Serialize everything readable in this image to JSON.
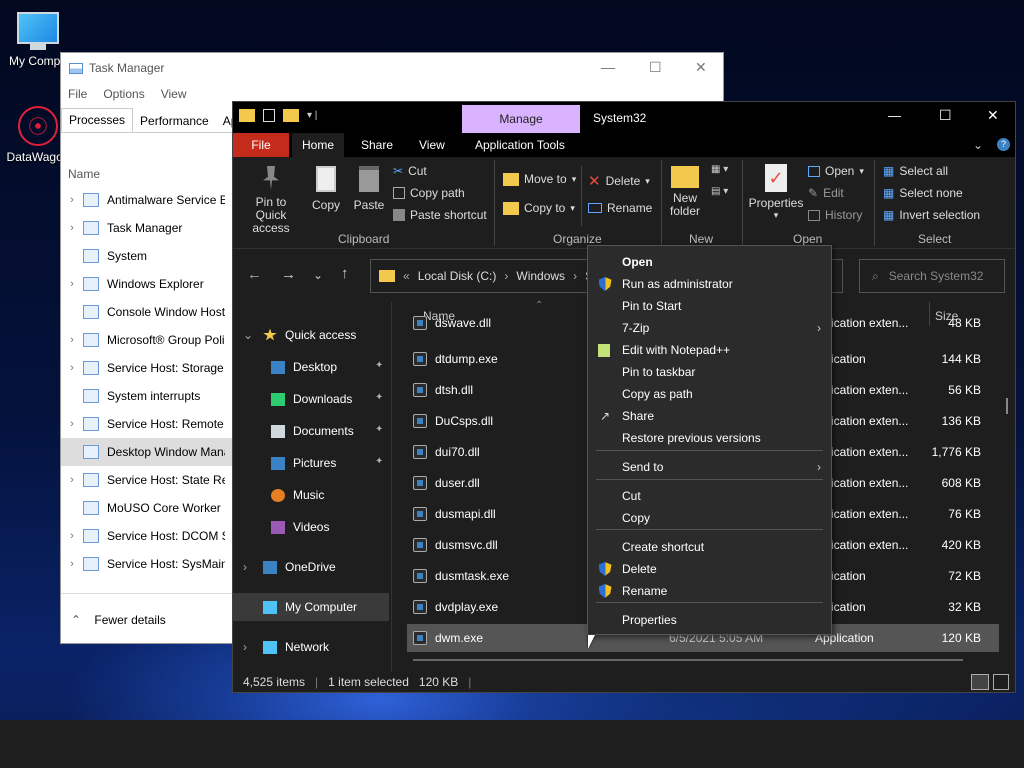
{
  "desktop": {
    "icons": [
      {
        "label": "My Computer",
        "display": "My Compu"
      },
      {
        "label": "DataWagon",
        "display": "DataWagon"
      }
    ]
  },
  "task_manager": {
    "title": "Task Manager",
    "menu": [
      "File",
      "Options",
      "View"
    ],
    "tabs": [
      "Processes",
      "Performance",
      "App"
    ],
    "column_name": "Name",
    "processes": [
      {
        "name": "Antimalware Service Ex",
        "expand": true
      },
      {
        "name": "Task Manager",
        "expand": true
      },
      {
        "name": "System",
        "expand": false
      },
      {
        "name": "Windows Explorer",
        "expand": true
      },
      {
        "name": "Console Window Host",
        "expand": false
      },
      {
        "name": "Microsoft® Group Poli",
        "expand": true
      },
      {
        "name": "Service Host: Storage S",
        "expand": true
      },
      {
        "name": "System interrupts",
        "expand": false
      },
      {
        "name": "Service Host: Remote P",
        "expand": true
      },
      {
        "name": "Desktop Window Mana",
        "expand": false
      },
      {
        "name": "Service Host: State Rep",
        "expand": true
      },
      {
        "name": "MoUSO Core Worker P",
        "expand": false
      },
      {
        "name": "Service Host: DCOM Se",
        "expand": true
      },
      {
        "name": "Service Host: SysMain",
        "expand": true
      }
    ],
    "fewer_details": "Fewer details"
  },
  "explorer": {
    "title": "System32",
    "manage_tab": "Manage",
    "ribbon_tabs": [
      "File",
      "Home",
      "Share",
      "View",
      "Application Tools"
    ],
    "clipboard": {
      "pin": "Pin to Quick access",
      "copy": "Copy",
      "paste": "Paste",
      "cut": "Cut",
      "copy_path": "Copy path",
      "paste_shortcut": "Paste shortcut",
      "group": "Clipboard"
    },
    "organize": {
      "move_to": "Move to",
      "copy_to": "Copy to",
      "delete": "Delete",
      "rename": "Rename",
      "group": "Organize"
    },
    "new": {
      "new_folder": "New folder",
      "group": "New"
    },
    "open": {
      "properties": "Properties",
      "open": "Open",
      "edit": "Edit",
      "history": "History",
      "group": "Open"
    },
    "select": {
      "select_all": "Select all",
      "select_none": "Select none",
      "invert": "Invert selection",
      "group": "Select"
    },
    "address": {
      "crumbs": [
        "Local Disk (C:)",
        "Windows",
        "S"
      ],
      "search_placeholder": "Search System32"
    },
    "columns": {
      "name": "Name",
      "size": "Size"
    },
    "nav": [
      {
        "label": "Quick access",
        "type": "star"
      },
      {
        "label": "Desktop",
        "type": "folder"
      },
      {
        "label": "Downloads",
        "type": "download"
      },
      {
        "label": "Documents",
        "type": "doc"
      },
      {
        "label": "Pictures",
        "type": "pic"
      },
      {
        "label": "Music",
        "type": "music"
      },
      {
        "label": "Videos",
        "type": "video"
      },
      {
        "label": "OneDrive",
        "type": "cloud"
      },
      {
        "label": "My Computer",
        "type": "pc"
      },
      {
        "label": "Network",
        "type": "net"
      }
    ],
    "files": [
      {
        "name": "dswave.dll",
        "type": "pplication exten...",
        "size": "48 KB"
      },
      {
        "name": "dtdump.exe",
        "type": "pplication",
        "size": "144 KB"
      },
      {
        "name": "dtsh.dll",
        "type": "pplication exten...",
        "size": "56 KB"
      },
      {
        "name": "DuCsps.dll",
        "type": "pplication exten...",
        "size": "136 KB"
      },
      {
        "name": "dui70.dll",
        "type": "pplication exten...",
        "size": "1,776 KB"
      },
      {
        "name": "duser.dll",
        "type": "pplication exten...",
        "size": "608 KB"
      },
      {
        "name": "dusmapi.dll",
        "type": "pplication exten...",
        "size": "76 KB"
      },
      {
        "name": "dusmsvc.dll",
        "type": "pplication exten...",
        "size": "420 KB"
      },
      {
        "name": "dusmtask.exe",
        "type": "pplication",
        "size": "72 KB"
      },
      {
        "name": "dvdplay.exe",
        "type": "pplication",
        "size": "32 KB"
      },
      {
        "name": "dwm.exe",
        "date": "6/5/2021 5:05 AM",
        "type": "Application",
        "size": "120 KB"
      }
    ],
    "status": {
      "items": "4,525 items",
      "selected": "1 item selected",
      "size": "120 KB"
    }
  },
  "context_menu": {
    "items": [
      {
        "label": "Open",
        "bold": true
      },
      {
        "label": "Run as administrator",
        "icon": "shield"
      },
      {
        "label": "Pin to Start"
      },
      {
        "label": "7-Zip",
        "submenu": true
      },
      {
        "label": "Edit with Notepad++",
        "icon": "notepad"
      },
      {
        "label": "Pin to taskbar"
      },
      {
        "label": "Copy as path"
      },
      {
        "label": "Share",
        "icon": "share"
      },
      {
        "label": "Restore previous versions"
      },
      {
        "label": "Send to",
        "submenu": true
      },
      {
        "label": "Cut"
      },
      {
        "label": "Copy"
      },
      {
        "label": "Create shortcut"
      },
      {
        "label": "Delete",
        "icon": "shield"
      },
      {
        "label": "Rename",
        "icon": "shield"
      },
      {
        "label": "Properties"
      }
    ]
  },
  "colors": {
    "file_tab": "#c42b1c",
    "manage_tab": "#d9b3ff",
    "accent": "#3b82c4"
  }
}
